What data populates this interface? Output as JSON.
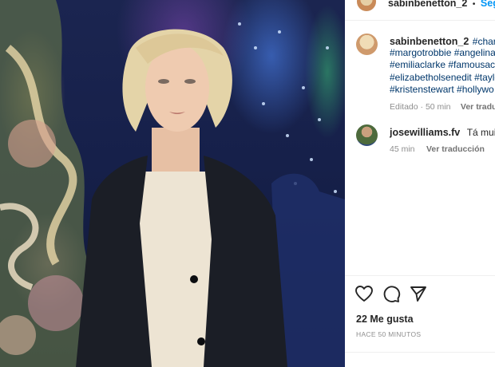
{
  "header": {
    "username": "sabinbenetton_2",
    "separator": "•",
    "follow_label": "Segui"
  },
  "caption": {
    "username": "sabinbenetton_2",
    "lines": [
      "#charliz",
      "#margotrobbie #angelina",
      "#emiliaclarke #famousact",
      "#elizabetholsenedit #taylo",
      "#kristenstewart #hollywo"
    ],
    "edited": "Editado · 50 min",
    "see_translation": "Ver traducc"
  },
  "comment": {
    "username": "josewilliams.fv",
    "text": "Tá muito l",
    "time": "45 min",
    "see_translation": "Ver traducción"
  },
  "actions": {
    "icons": [
      "heart-icon",
      "comment-icon",
      "share-icon"
    ]
  },
  "likes": {
    "label": "22 Me gusta"
  },
  "timestamp": {
    "label": "HACE 50 MINUTOS"
  },
  "colors": {
    "hashtag": "#00376b",
    "follow": "#0095f6",
    "meta": "#8e8e8e"
  }
}
